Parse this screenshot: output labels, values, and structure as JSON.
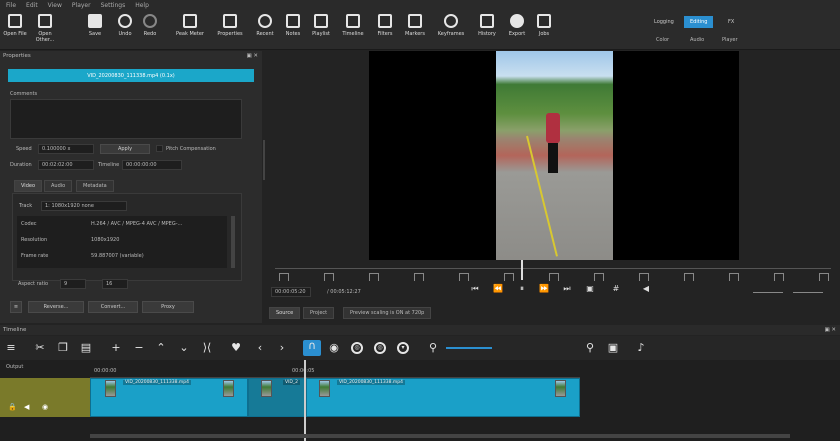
{
  "menu": [
    "File",
    "Edit",
    "View",
    "Player",
    "Settings",
    "Help"
  ],
  "toolbar": [
    {
      "label": "Open File",
      "icon": "folder-icon"
    },
    {
      "label": "Open Other...",
      "icon": "open-other-icon"
    },
    {
      "label": "Save",
      "icon": "save-icon"
    },
    {
      "label": "Undo",
      "icon": "undo-icon"
    },
    {
      "label": "Redo",
      "icon": "redo-icon"
    },
    {
      "label": "Peak Meter",
      "icon": "peak-meter-icon"
    },
    {
      "label": "Properties",
      "icon": "info-icon"
    },
    {
      "label": "Recent",
      "icon": "clock-icon"
    },
    {
      "label": "Notes",
      "icon": "notes-icon"
    },
    {
      "label": "Playlist",
      "icon": "playlist-icon"
    },
    {
      "label": "Timeline",
      "icon": "timeline-icon"
    },
    {
      "label": "Filters",
      "icon": "filters-icon"
    },
    {
      "label": "Markers",
      "icon": "markers-icon"
    },
    {
      "label": "Keyframes",
      "icon": "stopwatch-icon"
    },
    {
      "label": "History",
      "icon": "history-icon"
    },
    {
      "label": "Export",
      "icon": "export-icon"
    },
    {
      "label": "Jobs",
      "icon": "jobs-icon"
    }
  ],
  "layouts": {
    "top": [
      "Logging",
      "Editing",
      "FX"
    ],
    "bottom": [
      "Color",
      "Audio",
      "Player"
    ],
    "active": "Editing"
  },
  "properties": {
    "title": "Properties",
    "clip_name": "VID_20200830_111338.mp4 (0.1x)",
    "comments_label": "Comments",
    "speed_label": "Speed",
    "speed_value": "0.100000 x",
    "apply": "Apply",
    "pitch": "Pitch Compensation",
    "duration_label": "Duration",
    "duration_value": "00:02:02:00",
    "timeline_label": "Timeline",
    "timeline_value": "00:00:00:00",
    "tabs": [
      "Video",
      "Audio",
      "Metadata"
    ],
    "track_label": "Track",
    "track_value": "1: 1080x1920 none",
    "rows": [
      {
        "k": "Codec",
        "v": "H.264 / AVC / MPEG-4 AVC / MPEG-..."
      },
      {
        "k": "Resolution",
        "v": "1080x1920"
      },
      {
        "k": "Frame rate",
        "v": "59.887007 (variable)"
      }
    ],
    "aspect_label": "Aspect ratio",
    "aspect_a": "9",
    "aspect_b": "16",
    "btn_reverse": "Reverse...",
    "btn_convert": "Convert...",
    "btn_proxy": "Proxy"
  },
  "player": {
    "timecode": "00:00:05:20",
    "duration": "/ 00:05:12:27",
    "source_tab": "Source",
    "project_tab": "Project",
    "preview": "Preview scaling is ON at 720p"
  },
  "timeline": {
    "title": "Timeline",
    "track_name": "Output",
    "ruler": [
      "00:00:00",
      "00:00:05"
    ],
    "clips": [
      {
        "title": "VID_20200830_111338.mp4"
      },
      {
        "title": "VID_2"
      },
      {
        "title": "VID_20200830_111338.mp4"
      }
    ]
  }
}
